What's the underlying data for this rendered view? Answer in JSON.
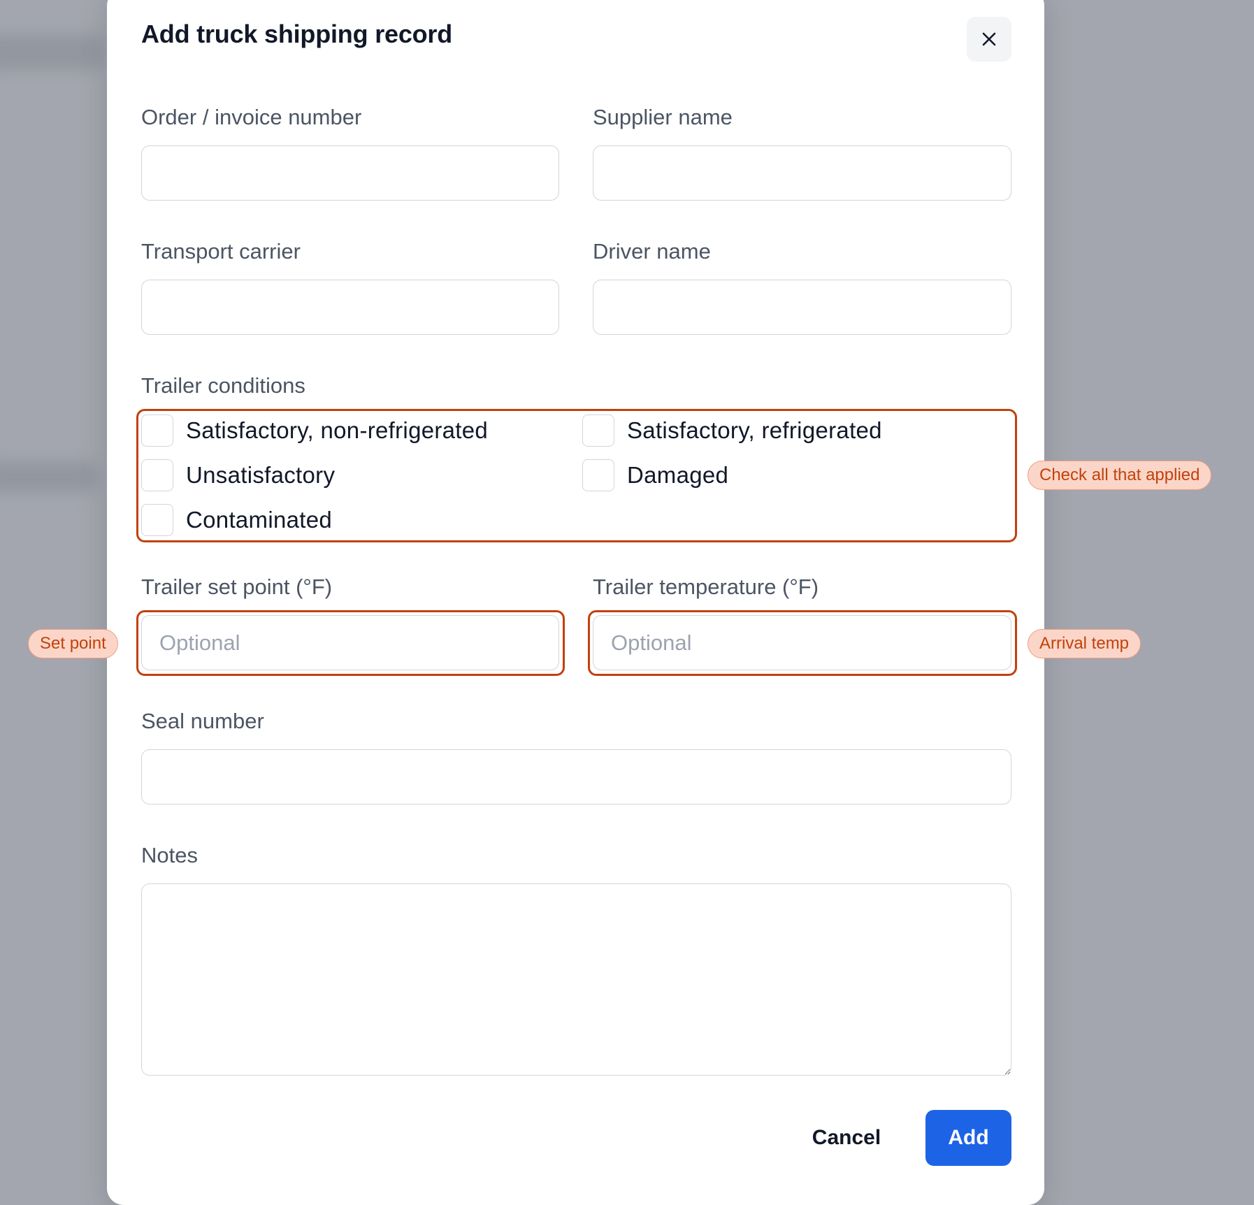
{
  "dialog": {
    "title": "Add truck shipping record",
    "close_icon": "close-icon"
  },
  "fields": {
    "order_invoice_number": {
      "label": "Order / invoice number",
      "value": "",
      "placeholder": ""
    },
    "supplier_name": {
      "label": "Supplier name",
      "value": "",
      "placeholder": ""
    },
    "transport_carrier": {
      "label": "Transport carrier",
      "value": "",
      "placeholder": ""
    },
    "driver_name": {
      "label": "Driver name",
      "value": "",
      "placeholder": ""
    },
    "trailer_set_point": {
      "label": "Trailer set point (°F)",
      "value": "",
      "placeholder": "Optional"
    },
    "trailer_temperature": {
      "label": "Trailer temperature (°F)",
      "value": "",
      "placeholder": "Optional"
    },
    "seal_number": {
      "label": "Seal number",
      "value": "",
      "placeholder": ""
    },
    "notes": {
      "label": "Notes",
      "value": "",
      "placeholder": ""
    }
  },
  "trailer_conditions": {
    "label": "Trailer conditions",
    "options": [
      {
        "label": "Satisfactory, non-refrigerated",
        "checked": false
      },
      {
        "label": "Satisfactory, refrigerated",
        "checked": false
      },
      {
        "label": "Unsatisfactory",
        "checked": false
      },
      {
        "label": "Damaged",
        "checked": false
      },
      {
        "label": "Contaminated",
        "checked": false
      }
    ]
  },
  "annotations": {
    "conditions_note": "Check all that applied",
    "set_point_note": "Set point",
    "arrival_temp_note": "Arrival temp",
    "highlight_color": "#c2410c"
  },
  "actions": {
    "cancel_label": "Cancel",
    "add_label": "Add",
    "primary_color": "#1d63e6"
  }
}
